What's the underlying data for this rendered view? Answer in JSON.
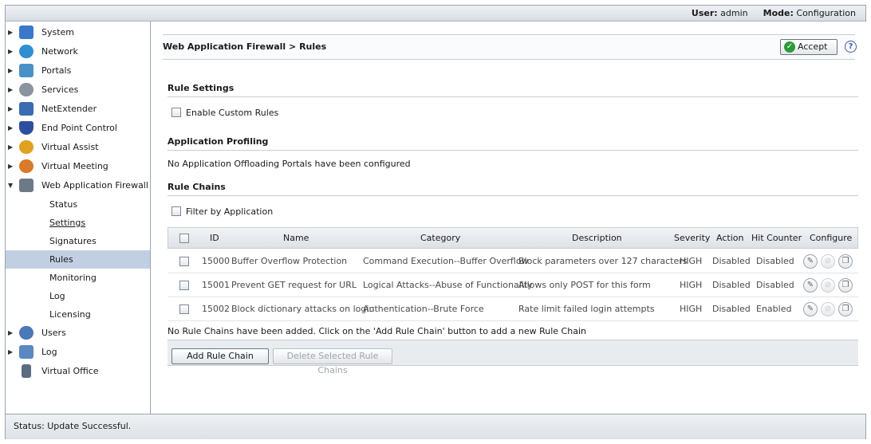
{
  "topbar": {
    "user_label": "User:",
    "user_value": "admin",
    "mode_label": "Mode:",
    "mode_value": "Configuration"
  },
  "sidebar": {
    "items": [
      {
        "label": "System",
        "icon": "monitor-icon",
        "color": "#3a78c8",
        "expanded": false
      },
      {
        "label": "Network",
        "icon": "globe-network-icon",
        "color": "#2f8fd0",
        "expanded": false
      },
      {
        "label": "Portals",
        "icon": "house-icon",
        "color": "#4a90c8",
        "expanded": false
      },
      {
        "label": "Services",
        "icon": "gears-icon",
        "color": "#8a949e",
        "expanded": false
      },
      {
        "label": "NetExtender",
        "icon": "netextender-icon",
        "color": "#3b6bb0",
        "expanded": false
      },
      {
        "label": "End Point Control",
        "icon": "shield-icon",
        "color": "#2c4fa0",
        "expanded": false
      },
      {
        "label": "Virtual Assist",
        "icon": "assist-person-icon",
        "color": "#e0a020",
        "expanded": false
      },
      {
        "label": "Virtual Meeting",
        "icon": "meeting-people-icon",
        "color": "#d87a2a",
        "expanded": false
      },
      {
        "label": "Web Application Firewall",
        "icon": "firewall-server-icon",
        "color": "#6c7a88",
        "expanded": true
      }
    ],
    "subitems": [
      {
        "label": "Status",
        "active": false,
        "link": false
      },
      {
        "label": "Settings",
        "active": false,
        "link": true
      },
      {
        "label": "Signatures",
        "active": false,
        "link": false
      },
      {
        "label": "Rules",
        "active": true,
        "link": false
      },
      {
        "label": "Monitoring",
        "active": false,
        "link": false
      },
      {
        "label": "Log",
        "active": false,
        "link": false
      },
      {
        "label": "Licensing",
        "active": false,
        "link": false
      }
    ],
    "items_after": [
      {
        "label": "Users",
        "icon": "users-icon",
        "color": "#4a78b8",
        "expanded": false
      },
      {
        "label": "Log",
        "icon": "log-magnifier-icon",
        "color": "#5a88c0",
        "expanded": false
      },
      {
        "label": "Virtual Office",
        "icon": "building-icon",
        "color": "#5b6c80",
        "expanded": null
      }
    ]
  },
  "main": {
    "title": "Web Application Firewall > Rules",
    "accept_label": "Accept",
    "help_icon": "help-icon",
    "rule_settings": {
      "heading": "Rule Settings",
      "enable_custom_rules": "Enable Custom Rules"
    },
    "application_profiling": {
      "heading": "Application Profiling",
      "message": "No Application Offloading Portals have been configured"
    },
    "rule_chains": {
      "heading": "Rule Chains",
      "filter_label": "Filter by Application",
      "columns": [
        "ID",
        "Name",
        "Category",
        "Description",
        "Severity",
        "Action",
        "Hit Counter",
        "Configure"
      ],
      "rows": [
        {
          "id": "15000",
          "name": "Buffer Overflow Protection",
          "category": "Command Execution--Buffer Overflow",
          "description": "Block parameters over 127 characters",
          "severity": "HIGH",
          "action": "Disabled",
          "hit_counter": "Disabled"
        },
        {
          "id": "15001",
          "name": "Prevent GET request for URL",
          "category": "Logical Attacks--Abuse of Functionality",
          "description": "Allows only POST for this form",
          "severity": "HIGH",
          "action": "Disabled",
          "hit_counter": "Disabled"
        },
        {
          "id": "15002",
          "name": "Block dictionary attacks on login",
          "category": "Authentication--Brute Force",
          "description": "Rate limit failed login attempts",
          "severity": "HIGH",
          "action": "Disabled",
          "hit_counter": "Enabled"
        }
      ],
      "empty_message": "No Rule Chains have been added. Click on the 'Add Rule Chain' button to add a new Rule Chain",
      "add_button": "Add Rule Chain",
      "delete_button": "Delete Selected Rule Chains"
    }
  },
  "status": {
    "text": "Status: Update Successful."
  }
}
